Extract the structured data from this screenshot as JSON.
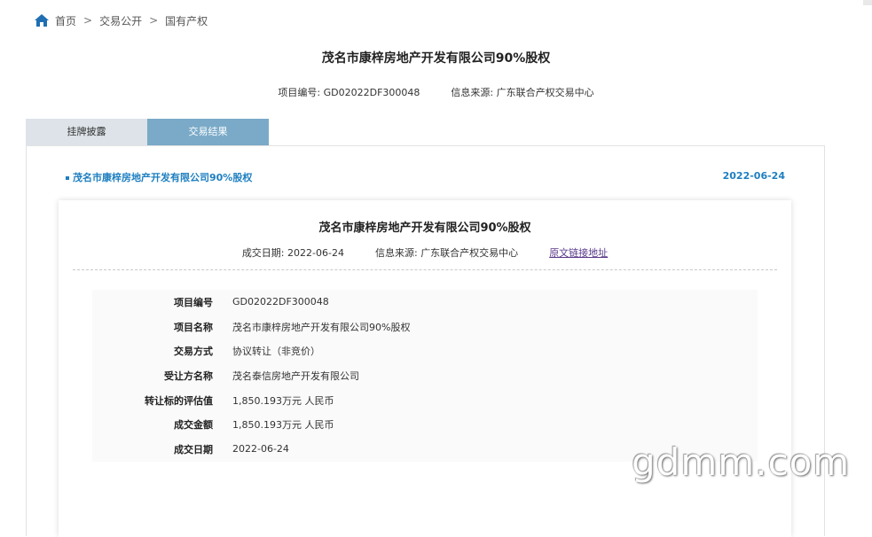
{
  "breadcrumb": {
    "home": "首页",
    "items": [
      "交易公开",
      "国有产权"
    ],
    "separator": ">"
  },
  "header": {
    "title": "茂名市康梓房地产开发有限公司90%股权",
    "project_no_label": "项目编号:",
    "project_no": "GD02022DF300048",
    "source_label": "信息来源:",
    "source": "广东联合产权交易中心"
  },
  "tabs": [
    {
      "label": "挂牌披露",
      "active": false
    },
    {
      "label": "交易结果",
      "active": true
    }
  ],
  "result": {
    "title": "茂名市康梓房地产开发有限公司90%股权",
    "date": "2022-06-24"
  },
  "card": {
    "title": "茂名市康梓房地产开发有限公司90%股权",
    "deal_date_label": "成交日期:",
    "deal_date": "2022-06-24",
    "source_label": "信息来源:",
    "source": "广东联合产权交易中心",
    "link_label": "原文链接地址",
    "rows": [
      {
        "label": "项目编号",
        "value": "GD02022DF300048"
      },
      {
        "label": "项目名称",
        "value": "茂名市康梓房地产开发有限公司90%股权"
      },
      {
        "label": "交易方式",
        "value": "协议转让（非竞价）"
      },
      {
        "label": "受让方名称",
        "value": "茂名泰信房地产开发有限公司"
      },
      {
        "label": "转让标的评估值",
        "value": "1,850.193万元 人民币"
      },
      {
        "label": "成交金额",
        "value": "1,850.193万元 人民币"
      },
      {
        "label": "成交日期",
        "value": "2022-06-24"
      }
    ]
  },
  "watermark": "gdmm.com",
  "colors": {
    "accent": "#1e7fc0",
    "tab_active": "#7aaac8",
    "tab_inactive": "#dde3e8",
    "home_icon": "#1f6fb2"
  },
  "icons": {
    "home": "home-icon"
  }
}
